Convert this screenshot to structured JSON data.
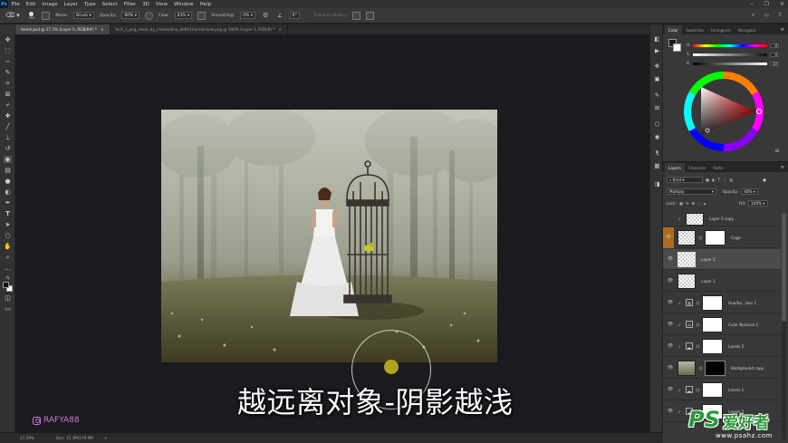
{
  "menu": {
    "app_icon": "Ps",
    "items": [
      "File",
      "Edit",
      "Image",
      "Layer",
      "Type",
      "Select",
      "Filter",
      "3D",
      "View",
      "Window",
      "Help"
    ]
  },
  "options": {
    "mode_label": "Mode:",
    "mode_value": "Brush",
    "opacity_label": "Opacity:",
    "opacity_value": "60%",
    "flow_label": "Flow:",
    "flow_value": "63%",
    "smoothing_label": "Smoothing:",
    "smoothing_value": "0%",
    "angle_value": "0°",
    "erase_history": "Erase to History",
    "brush_size": "500"
  },
  "tabs": [
    {
      "label": "forest.psd @ 27.3% (Layer 5, RGB/8#) *",
      "close": "×"
    },
    {
      "label": "bird_1_png_stock_by_ninadudina_db9h1mo-fullview.png @ 100% (Layer 1, RGB/8) *",
      "close": "×"
    }
  ],
  "status": {
    "zoom": "27.29%",
    "doc": "Doc: 15.3M/176.9M",
    "arrow": ">"
  },
  "subtitle": "越远离对象-阴影越浅",
  "watermark": "RAFYA88",
  "color_panel": {
    "tabs": [
      "Color",
      "Swatches",
      "Histogram",
      "Navigator"
    ],
    "sliders": [
      {
        "label": "H",
        "value": "0"
      },
      {
        "label": "S",
        "value": "0"
      },
      {
        "label": "B",
        "value": "10"
      }
    ]
  },
  "layers_panel": {
    "tabs": [
      "Layers",
      "Channels",
      "Paths"
    ],
    "filter": "Kind",
    "blend_mode": "Multiply",
    "opacity_label": "Opacity:",
    "opacity_value": "40%",
    "lock_label": "Lock:",
    "fill_label": "Fill:",
    "fill_value": "100%",
    "layers": [
      {
        "name": "Layer 5 copy"
      },
      {
        "name": "Cage"
      },
      {
        "name": "Layer 5"
      },
      {
        "name": "Layer 1"
      },
      {
        "name": "Hue/Sa...tion 1"
      },
      {
        "name": "Color Balance 2"
      },
      {
        "name": "Levels 2"
      },
      {
        "name": "Background copy"
      },
      {
        "name": "Levels 1"
      },
      {
        "name": "Levels 5"
      }
    ]
  },
  "site_logo": {
    "ps": "PS",
    "brand": "爱好者",
    "url": "www.psahz.com"
  },
  "colors": {
    "accent": "#31a8ff",
    "subtitle": "#ffffff",
    "watermark": "#c87ad4",
    "cursor": "#b2a21e"
  }
}
